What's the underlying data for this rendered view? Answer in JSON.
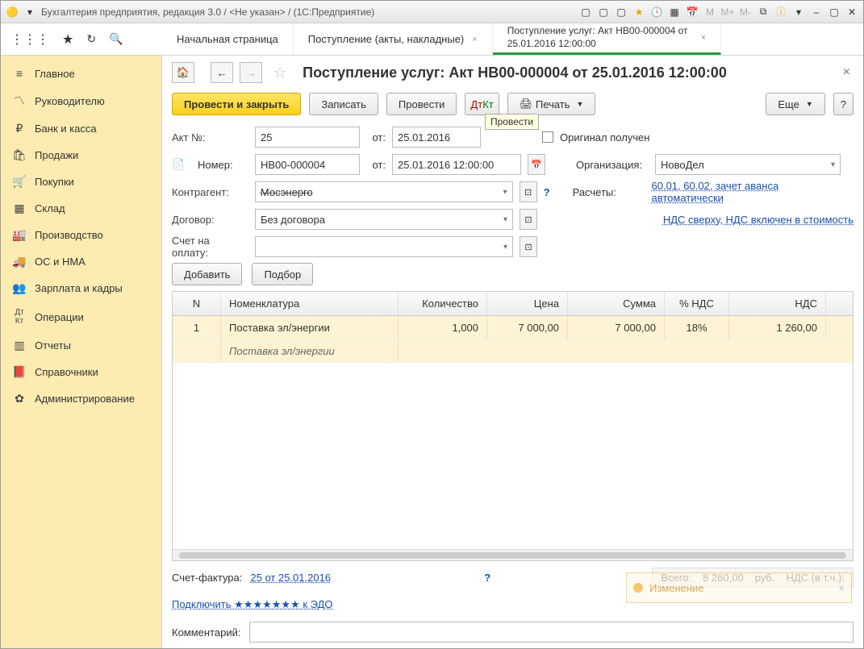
{
  "title": "Бухгалтерия предприятия, редакция 3.0 / <Не указан> / (1С:Предприятие)",
  "tabs": {
    "home": "Начальная страница",
    "t1": "Поступление (акты, накладные)",
    "t2": "Поступление услуг: Акт НВ00-000004 от 25.01.2016 12:00:00"
  },
  "sidebar": [
    "Главное",
    "Руководителю",
    "Банк и касса",
    "Продажи",
    "Покупки",
    "Склад",
    "Производство",
    "ОС и НМА",
    "Зарплата и кадры",
    "Операции",
    "Отчеты",
    "Справочники",
    "Администрирование"
  ],
  "doc": {
    "title": "Поступление услуг: Акт НВ00-000004 от 25.01.2016 12:00:00",
    "buttons": {
      "postClose": "Провести и закрыть",
      "save": "Записать",
      "post": "Провести",
      "print": "Печать",
      "more": "Еще",
      "help": "?",
      "add": "Добавить",
      "pick": "Подбор"
    },
    "tooltip": "Провести",
    "labels": {
      "actNo": "Акт №:",
      "from": "от:",
      "number": "Номер:",
      "orig": "Оригинал получен",
      "org": "Организация:",
      "contr": "Контрагент:",
      "calc": "Расчеты:",
      "dogovor": "Договор:",
      "schet": "Счет на оплату:",
      "sfact": "Счет-фактура:",
      "comment": "Комментарий:"
    },
    "values": {
      "actNo": "25",
      "actDate": "25.01.2016",
      "number": "НВ00-000004",
      "numDate": "25.01.2016 12:00:00",
      "org": "НовоДел",
      "contr": "Мосэнерго",
      "dogovor": "Без договора",
      "sfact": "25 от 25.01.2016",
      "edo": "Подключить ★★★★★★★ к ЭДО"
    },
    "links": {
      "calc": "60.01, 60.02, зачет аванса автоматически",
      "nds": "НДС сверху, НДС включен в стоимость"
    }
  },
  "table": {
    "headers": {
      "n": "N",
      "nom": "Номенклатура",
      "qty": "Количество",
      "price": "Цена",
      "sum": "Сумма",
      "vat": "% НДС",
      "vatv": "НДС"
    },
    "rows": [
      {
        "n": "1",
        "nom": "Поставка эл/энергии",
        "nom2": "Поставка эл/энергии",
        "qty": "1,000",
        "price": "7 000,00",
        "sum": "7 000,00",
        "vat": "18%",
        "vatv": "1 260,00"
      }
    ]
  },
  "totals": {
    "label": "Всего:",
    "sum": "8 260,00",
    "cur": "руб.",
    "ndsLabel": "НДС (в т.ч.):"
  },
  "notif": "Изменение"
}
